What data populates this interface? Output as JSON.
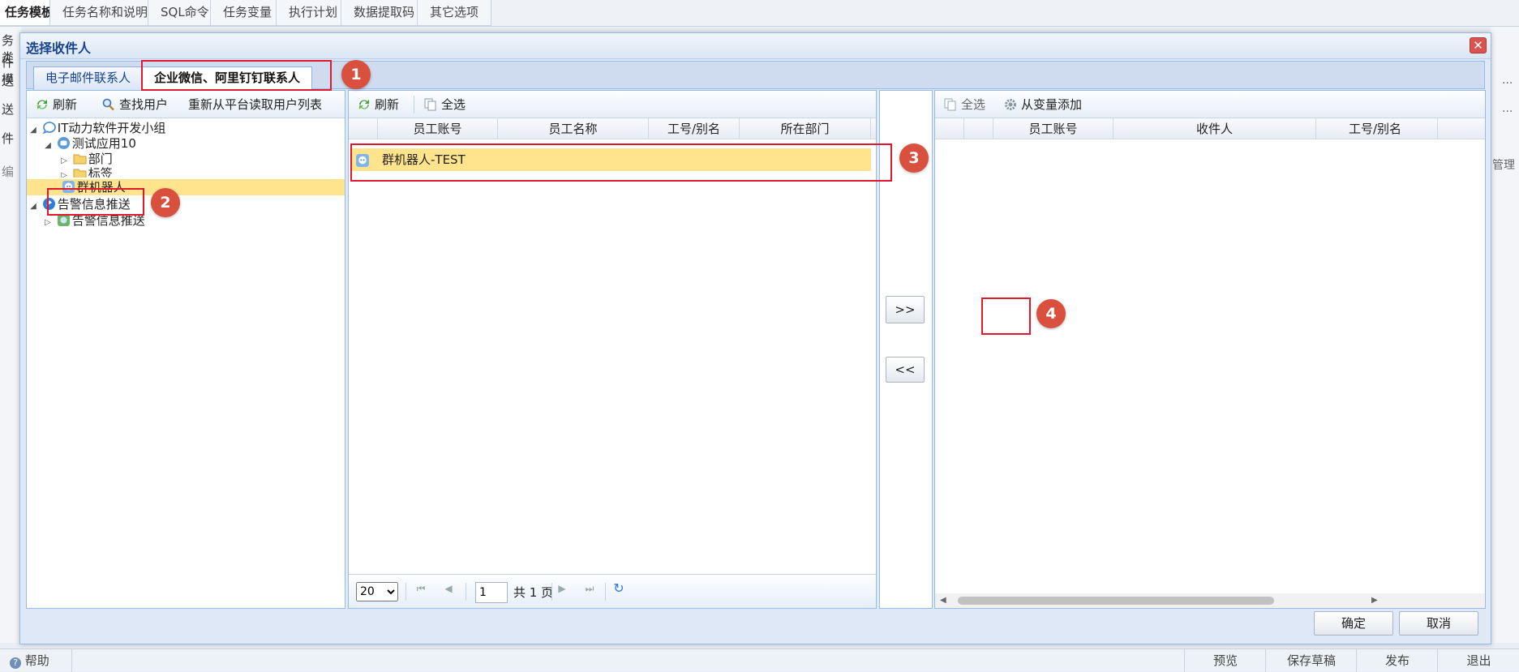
{
  "app": {
    "tabs": [
      "任务模板",
      "任务名称和说明",
      "SQL命令",
      "任务变量",
      "执行计划",
      "数据提取码",
      "其它选项"
    ],
    "left_labels": [
      "务类",
      "件模",
      "送",
      "送",
      "件",
      "编"
    ],
    "right_labels": [
      "...",
      "...",
      "管理"
    ],
    "bottom": {
      "help": "帮助",
      "preview": "预览",
      "save_draft": "保存草稿",
      "publish": "发布",
      "exit": "退出"
    }
  },
  "dialog": {
    "title": "选择收件人",
    "close": "✕",
    "tabs": [
      "电子邮件联系人",
      "企业微信、阿里钉钉联系人"
    ],
    "active_tab": 1,
    "tree_toolbar": {
      "refresh": "刷新",
      "find_user": "查找用户",
      "reload": "重新从平台读取用户列表"
    },
    "tree": [
      {
        "label": "IT动力软件开发小组",
        "icon": "chat-bubble-icon",
        "level": 0,
        "expanded": true
      },
      {
        "label": "测试应用10",
        "icon": "app-icon",
        "level": 1,
        "expanded": true
      },
      {
        "label": "部门",
        "icon": "folder-icon",
        "level": 2,
        "expanded": false
      },
      {
        "label": "标签",
        "icon": "folder-icon",
        "level": 2,
        "expanded": false
      },
      {
        "label": "群机器人",
        "icon": "robot-icon",
        "level": 2,
        "selected": true
      },
      {
        "label": "告警信息推送",
        "icon": "bell-icon",
        "level": 0,
        "expanded": true
      },
      {
        "label": "告警信息推送",
        "icon": "app-icon",
        "level": 1,
        "expanded": false
      }
    ],
    "middle": {
      "toolbar": {
        "refresh": "刷新",
        "select_all": "全选"
      },
      "columns": [
        "员工账号",
        "员工名称",
        "工号/别名",
        "所在部门"
      ],
      "rows": [
        {
          "account": "群机器人-TEST"
        }
      ],
      "pager": {
        "page_size": "20",
        "page": "1",
        "total_label": "共 1 页"
      }
    },
    "transfer": {
      "add": ">>",
      "remove": "<<"
    },
    "right": {
      "toolbar": {
        "select_all": "全选",
        "add_from_var": "从变量添加"
      },
      "columns": [
        "员工账号",
        "收件人",
        "工号/别名"
      ]
    },
    "footer": {
      "ok": "确定",
      "cancel": "取消"
    },
    "markers": [
      "1",
      "2",
      "3",
      "4"
    ],
    "colors": {
      "highlight": "#ffe48d",
      "annotation": "#e0182b",
      "marker": "#d9503f"
    }
  }
}
